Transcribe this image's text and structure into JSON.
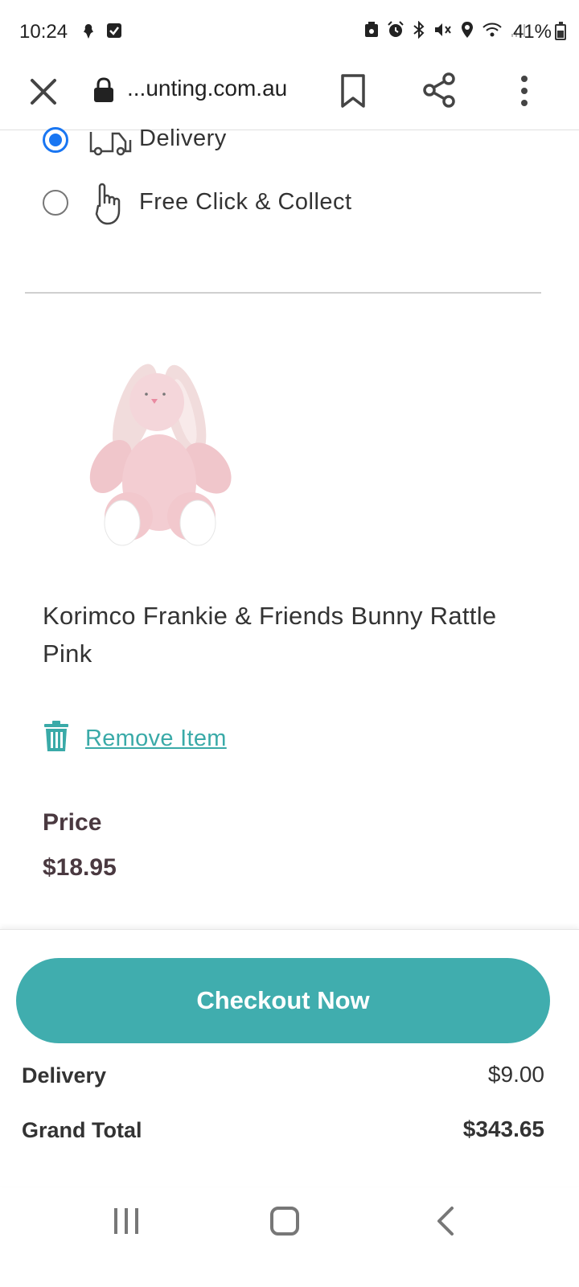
{
  "status_bar": {
    "time": "10:24",
    "battery": "41%",
    "icons_left": [
      "notification-icon",
      "checkbox-icon"
    ],
    "icons_right": [
      "save-icon",
      "alarm-icon",
      "bluetooth-icon",
      "mute-icon",
      "location-icon",
      "wifi-icon",
      "signal-icon"
    ]
  },
  "browser": {
    "url": "...unting.com.au",
    "icons": [
      "close-icon",
      "lock-icon",
      "bookmark-icon",
      "share-icon",
      "more-icon"
    ]
  },
  "delivery_options": [
    {
      "label": "Delivery",
      "selected": true,
      "icon": "truck-icon"
    },
    {
      "label": "Free Click & Collect",
      "selected": false,
      "icon": "pointer-hand-icon"
    }
  ],
  "product": {
    "name": "Korimco Frankie & Friends Bunny Rattle Pink",
    "image": "pink-bunny-plush",
    "remove_label": "Remove Item",
    "price_label": "Price",
    "price": "$18.95"
  },
  "summary": {
    "checkout_label": "Checkout Now",
    "delivery_label": "Delivery",
    "delivery_value": "$9.00",
    "grand_total_label": "Grand Total",
    "grand_total_value": "$343.65"
  },
  "colors": {
    "accent": "#40adae",
    "radio_selected": "#1976f2",
    "text_dark": "#4a3940"
  }
}
